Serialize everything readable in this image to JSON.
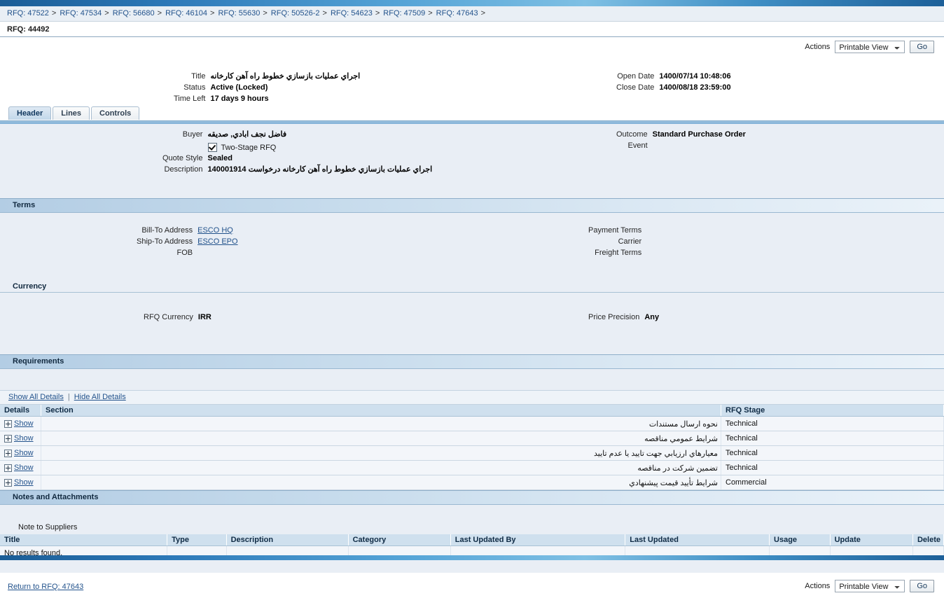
{
  "breadcrumb": {
    "items": [
      "RFQ: 47522",
      "RFQ: 47534",
      "RFQ: 56680",
      "RFQ: 46104",
      "RFQ: 55630",
      "RFQ: 50526-2",
      "RFQ: 54623",
      "RFQ: 47509",
      "RFQ: 47643"
    ],
    "separator": ">",
    "current": "RFQ: 44492"
  },
  "toolbar": {
    "actions_label": "Actions",
    "action_selected": "Printable View",
    "action_options": [
      "Printable View"
    ],
    "go_label": "Go"
  },
  "summary": {
    "title_label": "Title",
    "title_value": "اجراي عمليات بازسازي خطوط راه آهن كارخانه",
    "status_label": "Status",
    "status_value": "Active (Locked)",
    "time_left_label": "Time Left",
    "time_left_value": "17 days 9 hours",
    "open_date_label": "Open Date",
    "open_date_value": "1400/07/14 10:48:06",
    "close_date_label": "Close Date",
    "close_date_value": "1400/08/18 23:59:00"
  },
  "tabs": [
    {
      "label": "Header",
      "active": true
    },
    {
      "label": "Lines",
      "active": false
    },
    {
      "label": "Controls",
      "active": false
    }
  ],
  "header_section": {
    "buyer_label": "Buyer",
    "buyer_value": "فاضل نجف ابادي, صديقه",
    "two_stage_label": "Two-Stage RFQ",
    "two_stage_checked": true,
    "quote_style_label": "Quote Style",
    "quote_style_value": "Sealed",
    "description_label": "Description",
    "description_value": "اجراي عمليات بازسازي خطوط راه آهن كارخانه درخواست 140001914",
    "outcome_label": "Outcome",
    "outcome_value": "Standard Purchase Order",
    "event_label": "Event",
    "event_value": ""
  },
  "terms": {
    "section_title": "Terms",
    "bill_to_label": "Bill-To Address",
    "bill_to_value": "ESCO HQ",
    "ship_to_label": "Ship-To Address",
    "ship_to_value": "ESCO EPO",
    "fob_label": "FOB",
    "fob_value": "",
    "payment_terms_label": "Payment Terms",
    "payment_terms_value": "",
    "carrier_label": "Carrier",
    "carrier_value": "",
    "freight_terms_label": "Freight Terms",
    "freight_terms_value": ""
  },
  "currency": {
    "section_title": "Currency",
    "rfq_currency_label": "RFQ Currency",
    "rfq_currency_value": "IRR",
    "price_precision_label": "Price Precision",
    "price_precision_value": "Any"
  },
  "requirements": {
    "section_title": "Requirements",
    "show_all_label": "Show All Details",
    "hide_all_label": "Hide All Details",
    "columns": [
      "Details",
      "Section",
      "RFQ Stage"
    ],
    "show_label": "Show",
    "rows": [
      {
        "section": "نحوه ارسال مستندات",
        "stage": "Technical"
      },
      {
        "section": "شرايط عمومي مناقصه",
        "stage": "Technical"
      },
      {
        "section": "معيارهاي ارزيابي جهت تاييد يا عدم تاييد",
        "stage": "Technical"
      },
      {
        "section": "تضمين شركت در مناقصه",
        "stage": "Technical"
      },
      {
        "section": "شرايط تأييد قيمت پيشنهادي",
        "stage": "Commercial"
      }
    ]
  },
  "notes": {
    "section_title": "Notes and Attachments",
    "note_to_suppliers_label": "Note to Suppliers",
    "columns": [
      "Title",
      "Type",
      "Description",
      "Category",
      "Last Updated By",
      "Last Updated",
      "Usage",
      "Update",
      "Delete"
    ],
    "empty_message": "No results found."
  },
  "footer": {
    "return_link": "Return to RFQ: 47643",
    "actions_label": "Actions",
    "action_selected": "Printable View",
    "go_label": "Go"
  },
  "colors": {
    "accent_blue": "#2d79b8",
    "link_blue": "#23538c",
    "panel_bg": "#e9eef5",
    "section_bar": "#b3cde4",
    "grid_header": "#cfe0ee"
  }
}
